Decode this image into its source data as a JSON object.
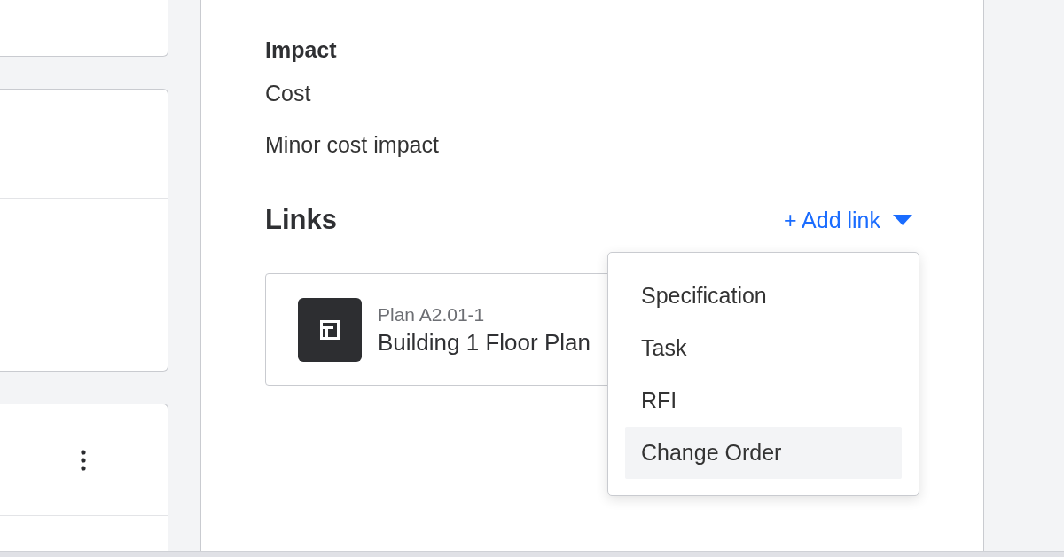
{
  "impact": {
    "heading": "Impact",
    "lines": [
      "Cost",
      "Minor cost impact"
    ]
  },
  "links": {
    "heading": "Links",
    "add_link": "+ Add link",
    "items": [
      {
        "label": "Plan A2.01-1",
        "title": "Building 1 Floor Plan"
      }
    ]
  },
  "menu": {
    "items": [
      {
        "label": "Specification",
        "selected": false
      },
      {
        "label": "Task",
        "selected": false
      },
      {
        "label": "RFI",
        "selected": false
      },
      {
        "label": "Change Order",
        "selected": true
      }
    ]
  }
}
